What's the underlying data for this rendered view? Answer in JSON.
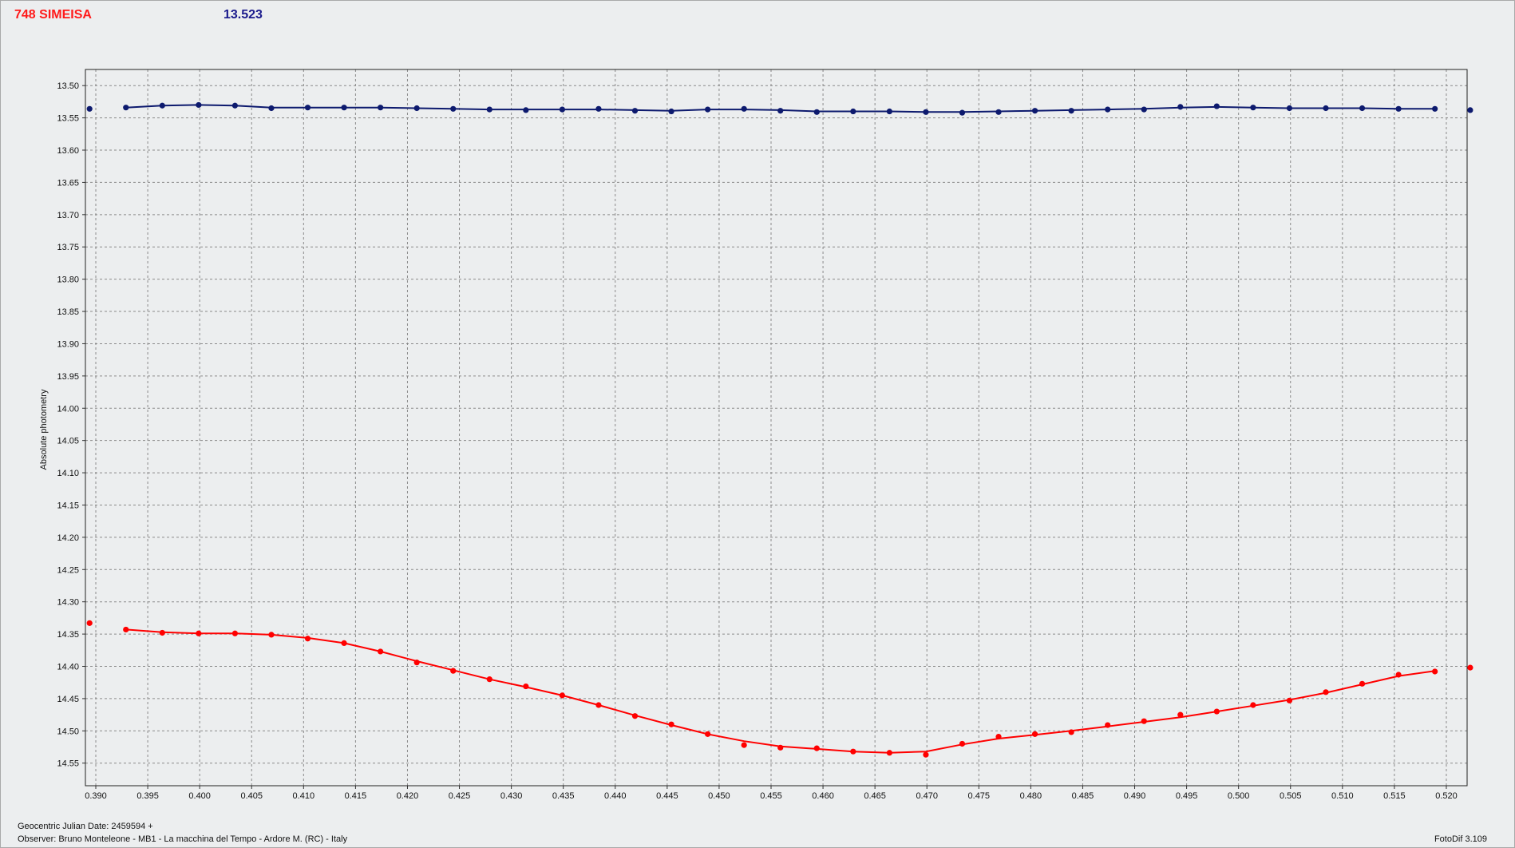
{
  "header": {
    "object_name": "748 SIMEISA",
    "comparison_mag": "13.523"
  },
  "footer": {
    "julian_date_label": "Geocentric Julian Date: 2459594 +",
    "observer_label": "Observer: Bruno Monteleone - MB1 - La macchina del Tempo - Ardore M. (RC) - Italy",
    "version_label": "FotoDif 3.109"
  },
  "colors": {
    "target_series": "#ff0000",
    "comparison_series": "#0d1a6e",
    "grid": "#8a8a8a",
    "plot_background": "#eceeef"
  },
  "chart_data": {
    "type": "scatter",
    "title": "748 SIMEISA",
    "xlabel": "",
    "ylabel": "Absolute photometry",
    "xlim": [
      0.389,
      0.522
    ],
    "ylim": [
      13.475,
      14.585
    ],
    "y_inverted": true,
    "grid": true,
    "x_ticks": [
      "0.390",
      "0.395",
      "0.400",
      "0.405",
      "0.410",
      "0.415",
      "0.420",
      "0.425",
      "0.430",
      "0.435",
      "0.440",
      "0.445",
      "0.450",
      "0.455",
      "0.460",
      "0.465",
      "0.470",
      "0.475",
      "0.480",
      "0.485",
      "0.490",
      "0.495",
      "0.500",
      "0.505",
      "0.510",
      "0.515",
      "0.520"
    ],
    "y_ticks": [
      "13.50",
      "13.55",
      "13.60",
      "13.65",
      "13.70",
      "13.75",
      "13.80",
      "13.85",
      "13.90",
      "13.95",
      "14.00",
      "14.05",
      "14.10",
      "14.15",
      "14.20",
      "14.25",
      "14.30",
      "14.35",
      "14.40",
      "14.45",
      "14.50",
      "14.55"
    ],
    "series": [
      {
        "color": "#0d1a6e",
        "x": [
          0.3894,
          0.3929,
          0.3964,
          0.3999,
          0.4034,
          0.4069,
          0.4104,
          0.4139,
          0.4174,
          0.4209,
          0.4244,
          0.4279,
          0.4314,
          0.4349,
          0.4384,
          0.4419,
          0.4454,
          0.4489,
          0.4524,
          0.4559,
          0.4594,
          0.4629,
          0.4664,
          0.4699,
          0.4734,
          0.4769,
          0.4804,
          0.4839,
          0.4874,
          0.4909,
          0.4944,
          0.4979,
          0.5014,
          0.5049,
          0.5084,
          0.5119,
          0.5154,
          0.5189,
          0.5223
        ],
        "y": [
          13.536,
          13.534,
          13.531,
          13.53,
          13.531,
          13.535,
          13.534,
          13.534,
          13.534,
          13.535,
          13.536,
          13.537,
          13.538,
          13.537,
          13.536,
          13.539,
          13.54,
          13.537,
          13.536,
          13.539,
          13.541,
          13.54,
          13.54,
          13.541,
          13.542,
          13.541,
          13.539,
          13.539,
          13.537,
          13.537,
          13.533,
          13.532,
          13.534,
          13.535,
          13.535,
          13.535,
          13.536,
          13.536,
          13.538
        ],
        "fit_x": [
          0.3929,
          0.3964,
          0.3999,
          0.4034,
          0.4069,
          0.4104,
          0.4139,
          0.4174,
          0.4209,
          0.4244,
          0.4279,
          0.4314,
          0.4349,
          0.4384,
          0.4419,
          0.4454,
          0.4489,
          0.4524,
          0.4559,
          0.4594,
          0.4629,
          0.4664,
          0.4699,
          0.4734,
          0.4769,
          0.4804,
          0.4839,
          0.4874,
          0.4909,
          0.4944,
          0.4979,
          0.5014,
          0.5049,
          0.5084,
          0.5119,
          0.5154,
          0.5189
        ],
        "fit_y": [
          13.534,
          13.531,
          13.53,
          13.531,
          13.534,
          13.534,
          13.534,
          13.534,
          13.535,
          13.536,
          13.537,
          13.537,
          13.537,
          13.537,
          13.538,
          13.539,
          13.537,
          13.537,
          13.538,
          13.54,
          13.54,
          13.54,
          13.541,
          13.541,
          13.54,
          13.539,
          13.538,
          13.537,
          13.536,
          13.534,
          13.533,
          13.534,
          13.535,
          13.535,
          13.535,
          13.536,
          13.536
        ]
      },
      {
        "color": "#ff0000",
        "x": [
          0.3894,
          0.3929,
          0.3964,
          0.3999,
          0.4034,
          0.4069,
          0.4104,
          0.4139,
          0.4174,
          0.4209,
          0.4244,
          0.4279,
          0.4314,
          0.4349,
          0.4384,
          0.4419,
          0.4454,
          0.4489,
          0.4524,
          0.4559,
          0.4594,
          0.4629,
          0.4664,
          0.4699,
          0.4734,
          0.4769,
          0.4804,
          0.4839,
          0.4874,
          0.4909,
          0.4944,
          0.4979,
          0.5014,
          0.5049,
          0.5084,
          0.5119,
          0.5154,
          0.5189,
          0.5223
        ],
        "y": [
          14.333,
          14.343,
          14.348,
          14.349,
          14.349,
          14.351,
          14.357,
          14.364,
          14.377,
          14.394,
          14.407,
          14.42,
          14.431,
          14.445,
          14.46,
          14.477,
          14.49,
          14.505,
          14.522,
          14.526,
          14.527,
          14.532,
          14.534,
          14.537,
          14.52,
          14.509,
          14.505,
          14.502,
          14.491,
          14.485,
          14.475,
          14.47,
          14.46,
          14.453,
          14.44,
          14.427,
          14.413,
          14.408,
          14.402
        ],
        "fit_x": [
          0.3929,
          0.3964,
          0.3999,
          0.4034,
          0.4069,
          0.4104,
          0.4139,
          0.4174,
          0.4209,
          0.4244,
          0.4279,
          0.4314,
          0.4349,
          0.4384,
          0.4419,
          0.4454,
          0.4489,
          0.4524,
          0.4559,
          0.4594,
          0.4629,
          0.4664,
          0.4699,
          0.4734,
          0.4769,
          0.4804,
          0.4839,
          0.4874,
          0.4909,
          0.4944,
          0.4979,
          0.5014,
          0.5049,
          0.5084,
          0.5119,
          0.5154,
          0.5189
        ],
        "fit_y": [
          14.343,
          14.347,
          14.349,
          14.349,
          14.351,
          14.356,
          14.364,
          14.377,
          14.392,
          14.406,
          14.42,
          14.432,
          14.445,
          14.46,
          14.476,
          14.491,
          14.505,
          14.516,
          14.524,
          14.528,
          14.532,
          14.534,
          14.532,
          14.521,
          14.512,
          14.506,
          14.5,
          14.493,
          14.486,
          14.479,
          14.47,
          14.461,
          14.452,
          14.441,
          14.428,
          14.415,
          14.407
        ]
      }
    ]
  }
}
